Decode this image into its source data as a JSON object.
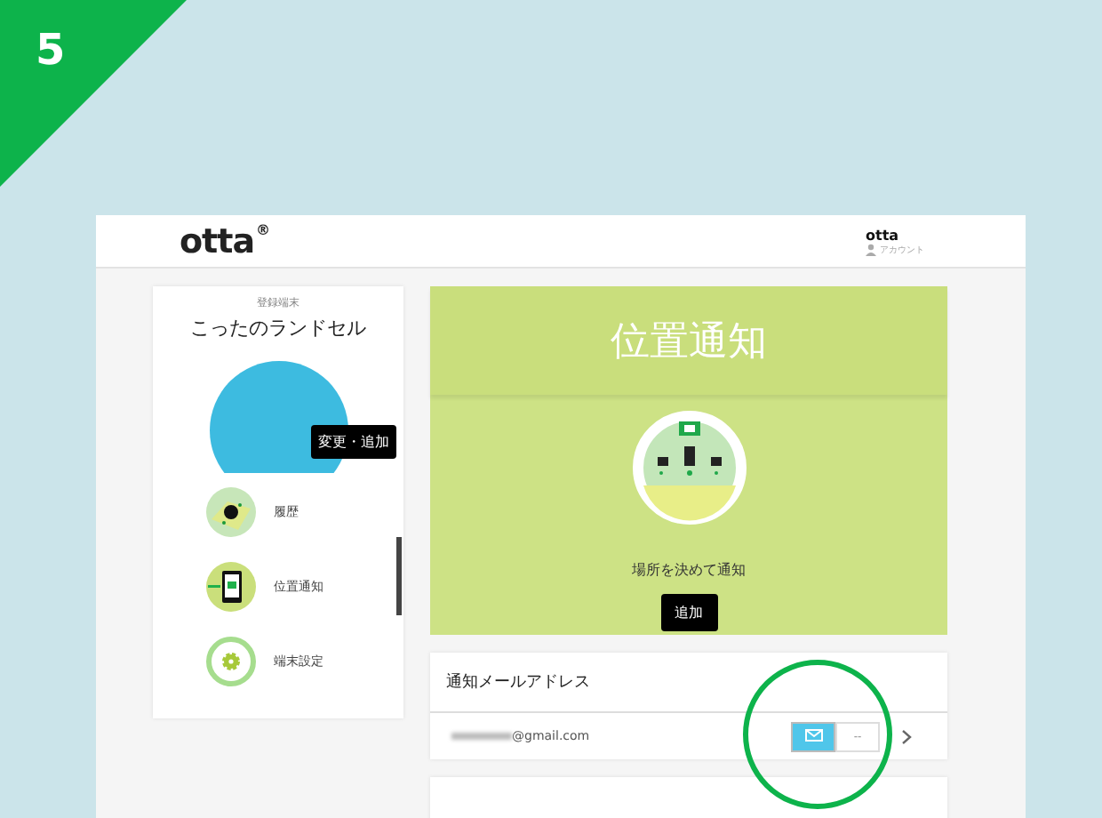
{
  "step_badge": "5",
  "header": {
    "logo": "otta",
    "logo_mark": "®",
    "user_name": "otta",
    "account_link": "アカウント"
  },
  "device": {
    "caption": "登録端末",
    "name": "こったのランドセル",
    "change_button": "変更・追加"
  },
  "menu": [
    {
      "kind": "history",
      "label": "履歴"
    },
    {
      "kind": "notify",
      "label": "位置通知"
    },
    {
      "kind": "settings",
      "label": "端末設定"
    }
  ],
  "hero": {
    "title": "位置通知",
    "description": "場所を決めて通知",
    "add_button": "追加"
  },
  "mail_card": {
    "title": "通知メールアドレス",
    "address_visible": "@gmail.com",
    "mail_on": true,
    "off_label": "--"
  }
}
